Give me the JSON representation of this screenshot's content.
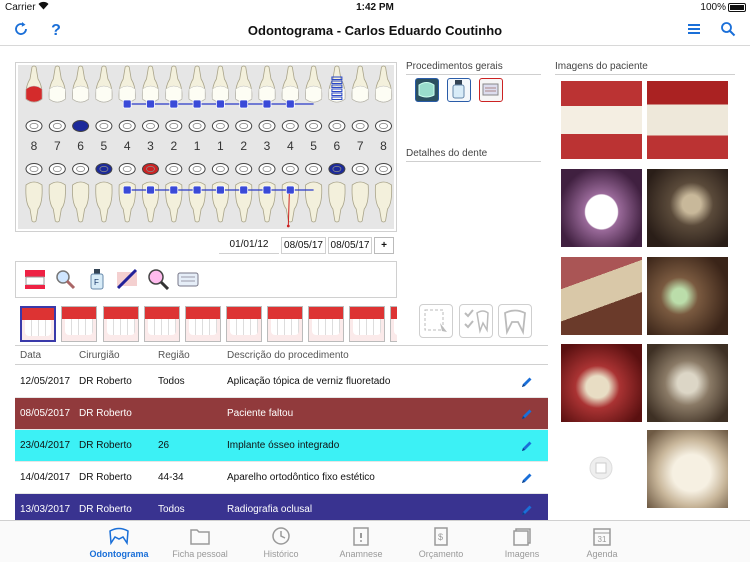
{
  "status_bar": {
    "carrier": "Carrier",
    "time": "1:42 PM",
    "battery": "100%"
  },
  "navbar": {
    "title": "Odontograma - Carlos Eduardo Coutinho"
  },
  "odontogram": {
    "upper_numbers": [
      "8",
      "7",
      "6",
      "5",
      "4",
      "3",
      "2",
      "1",
      "1",
      "2",
      "3",
      "4",
      "5",
      "6",
      "7",
      "8"
    ],
    "dates": [
      "01/01/12",
      "08/05/17",
      "08/05/17"
    ],
    "add_label": "+"
  },
  "sections": {
    "procedimentos": "Procedimentos gerais",
    "detalhes": "Detalhes do dente",
    "imagens": "Imagens do paciente"
  },
  "table": {
    "headers": {
      "data": "Data",
      "cirurgiao": "Cirurgião",
      "regiao": "Região",
      "descricao": "Descrição do procedimento"
    },
    "rows": [
      {
        "data": "12/05/2017",
        "cirurgiao": "DR Roberto",
        "regiao": "Todos",
        "descricao": "Aplicação tópica de verniz fluoretado",
        "color": "#ffffff",
        "text_color": "#111111"
      },
      {
        "data": "08/05/2017",
        "cirurgiao": "DR Roberto",
        "regiao": "",
        "descricao": "Paciente faltou",
        "color": "#913a3c",
        "text_color": "#ffffff"
      },
      {
        "data": "23/04/2017",
        "cirurgiao": "DR Roberto",
        "regiao": "26",
        "descricao": "Implante ósseo integrado",
        "color": "#3cf1f5",
        "text_color": "#111111"
      },
      {
        "data": "14/04/2017",
        "cirurgiao": "DR Roberto",
        "regiao": "44-34",
        "descricao": "Aparelho ortodôntico fixo estético",
        "color": "#ffffff",
        "text_color": "#111111"
      },
      {
        "data": "13/03/2017",
        "cirurgiao": "DR Roberto",
        "regiao": "Todos",
        "descricao": "Radiografia oclusal",
        "color": "#393390",
        "text_color": "#ffffff"
      }
    ]
  },
  "tabs": [
    {
      "label": "Odontograma",
      "icon": "teeth-icon",
      "active": true
    },
    {
      "label": "Ficha pessoal",
      "icon": "folder-icon",
      "active": false
    },
    {
      "label": "Histórico",
      "icon": "history-icon",
      "active": false
    },
    {
      "label": "Anamnese",
      "icon": "clipboard-icon",
      "active": false
    },
    {
      "label": "Orçamento",
      "icon": "budget-icon",
      "active": false
    },
    {
      "label": "Imagens",
      "icon": "images-icon",
      "active": false
    },
    {
      "label": "Agenda",
      "icon": "calendar-icon",
      "active": false
    }
  ],
  "colors": {
    "accent": "#1a6fd8",
    "cavity_red": "#cc2222",
    "filling_blue": "#1c2a9a"
  }
}
